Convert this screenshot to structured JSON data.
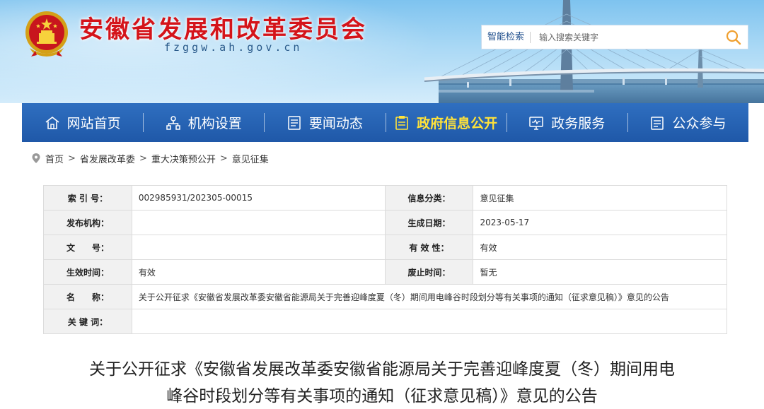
{
  "header": {
    "site_title": "安徽省发展和改革委员会",
    "site_domain": "fzggw.ah.gov.cn",
    "search": {
      "label": "智能检索",
      "placeholder": "输入搜索关键字",
      "button_icon": "search-icon"
    },
    "emblem_icon": "national-emblem-icon"
  },
  "nav": {
    "items": [
      {
        "label": "网站首页",
        "icon": "home-icon",
        "active": false
      },
      {
        "label": "机构设置",
        "icon": "org-chart-icon",
        "active": false
      },
      {
        "label": "要闻动态",
        "icon": "news-icon",
        "active": false
      },
      {
        "label": "政府信息公开",
        "icon": "info-disclosure-icon",
        "active": true
      },
      {
        "label": "政务服务",
        "icon": "monitor-icon",
        "active": false
      },
      {
        "label": "公众参与",
        "icon": "clipboard-icon",
        "active": false
      }
    ],
    "active_color": "#ffe23a",
    "bg_color": "#2266b3"
  },
  "breadcrumb": {
    "icon": "location-pin-icon",
    "items": [
      "首页",
      "省发展改革委",
      "重大决策预公开",
      "意见征集"
    ],
    "separator": ">"
  },
  "info": {
    "index_no": {
      "label": "索 引 号：",
      "value": "002985931/202305-00015"
    },
    "category": {
      "label": "信息分类：",
      "value": "意见征集"
    },
    "publisher": {
      "label": "发布机构：",
      "value": ""
    },
    "created_date": {
      "label": "生成日期：",
      "value": "2023-05-17"
    },
    "doc_no": {
      "label": "文　　号：",
      "value": ""
    },
    "validity": {
      "label": "有 效 性：",
      "value": "有效"
    },
    "effective_time": {
      "label": "生效时间：",
      "value": "有效"
    },
    "expiry_time": {
      "label": "废止时间：",
      "value": "暂无"
    },
    "name": {
      "label": "名　　称：",
      "value": "关于公开征求《安徽省发展改革委安徽省能源局关于完善迎峰度夏（冬）期间用电峰谷时段划分等有关事项的通知（征求意见稿）》意见的公告"
    },
    "keywords": {
      "label": "关 键 词：",
      "value": ""
    }
  },
  "article": {
    "title_line1": "关于公开征求《安徽省发展改革委安徽省能源局关于完善迎峰度夏（冬）期间用电",
    "title_line2": "峰谷时段划分等有关事项的通知（征求意见稿）》意见的公告"
  }
}
